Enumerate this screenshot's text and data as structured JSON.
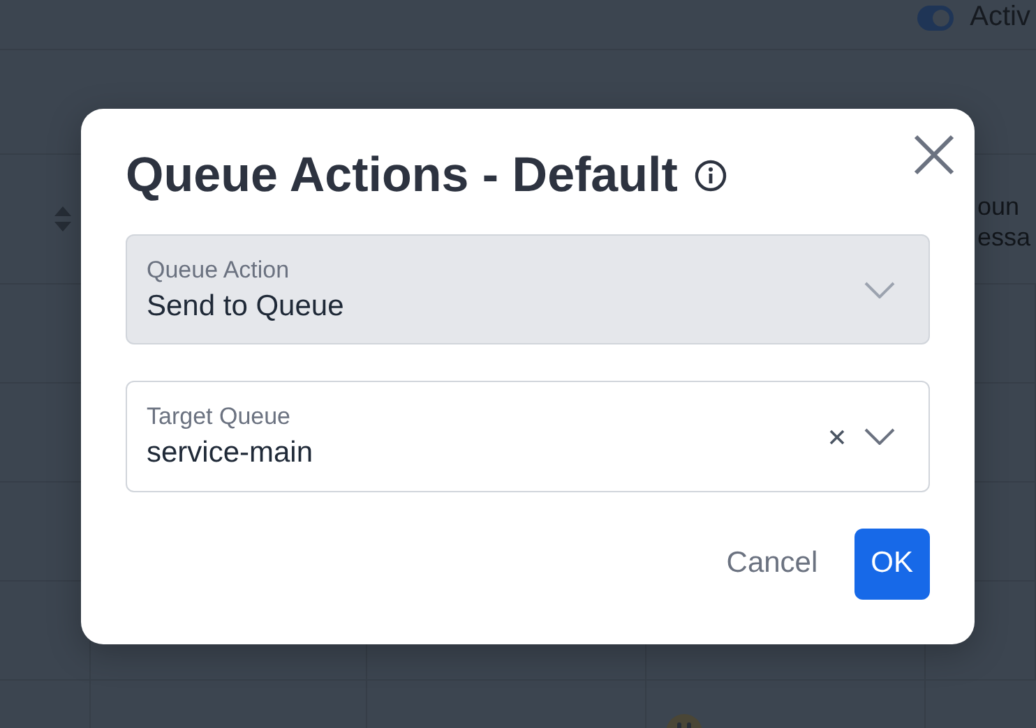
{
  "background": {
    "toggle": {
      "label": "Activ",
      "on": true
    },
    "table": {
      "sortable_first_column": true,
      "column_5_heading": [
        "oun",
        "essa"
      ]
    }
  },
  "dialog": {
    "title": "Queue Actions - Default",
    "fields": [
      {
        "label": "Queue Action",
        "value": "Send to Queue",
        "disabled": true,
        "clearable": false
      },
      {
        "label": "Target Queue",
        "value": "service-main",
        "disabled": false,
        "clearable": true
      }
    ],
    "buttons": [
      {
        "label": "Cancel",
        "kind": "secondary"
      },
      {
        "label": "OK",
        "kind": "primary"
      }
    ]
  }
}
